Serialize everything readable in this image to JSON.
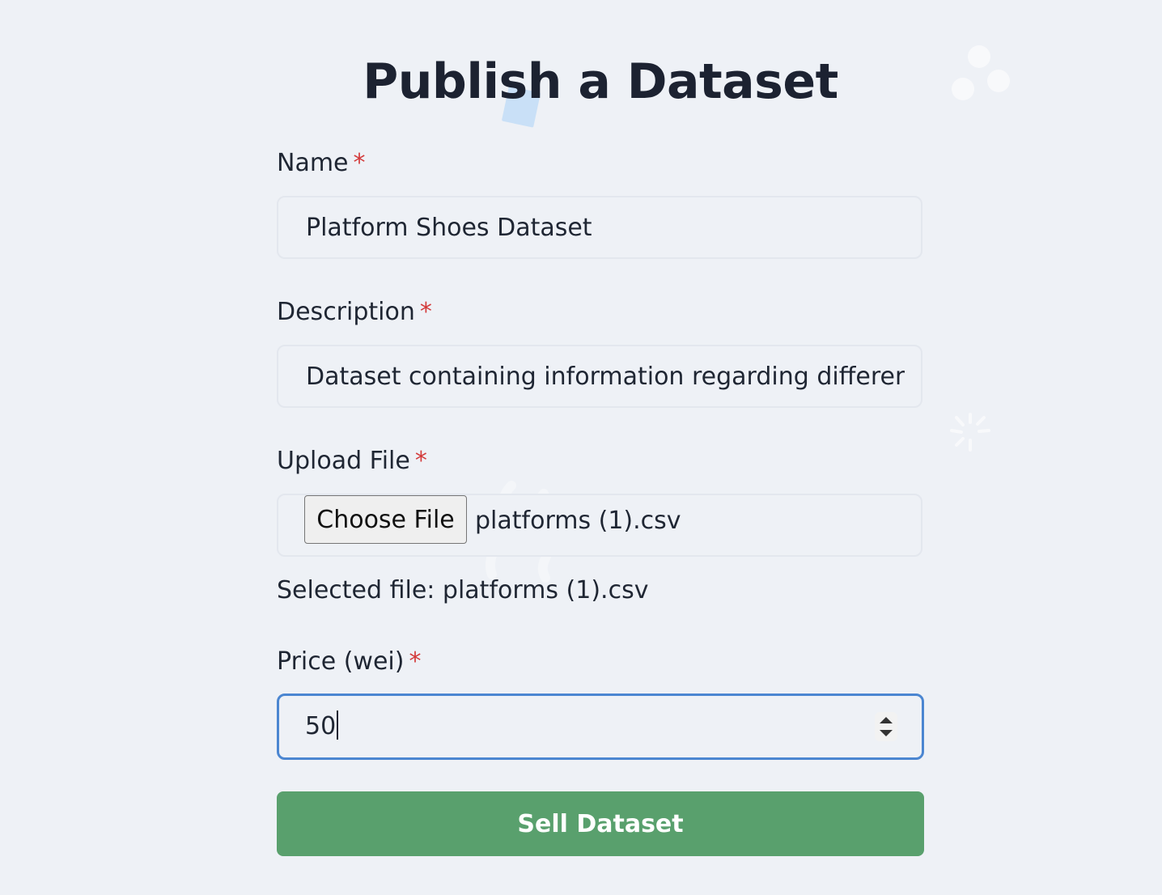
{
  "page_title": "Publish a Dataset",
  "form": {
    "name": {
      "label": "Name",
      "required_mark": "*",
      "value": "Platform Shoes Dataset"
    },
    "description": {
      "label": "Description",
      "required_mark": "*",
      "value": "Dataset containing information regarding different"
    },
    "upload": {
      "label": "Upload File",
      "required_mark": "*",
      "button_label": "Choose File",
      "file_name": "platforms (1).csv",
      "selected_text": "Selected file: platforms (1).csv"
    },
    "price": {
      "label": "Price (wei)",
      "required_mark": "*",
      "value": "50"
    },
    "submit_label": "Sell Dataset"
  },
  "colors": {
    "background": "#eef1f6",
    "required": "#d33a3a",
    "focus_border": "#4b86d1",
    "submit_bg": "#59a06d"
  }
}
